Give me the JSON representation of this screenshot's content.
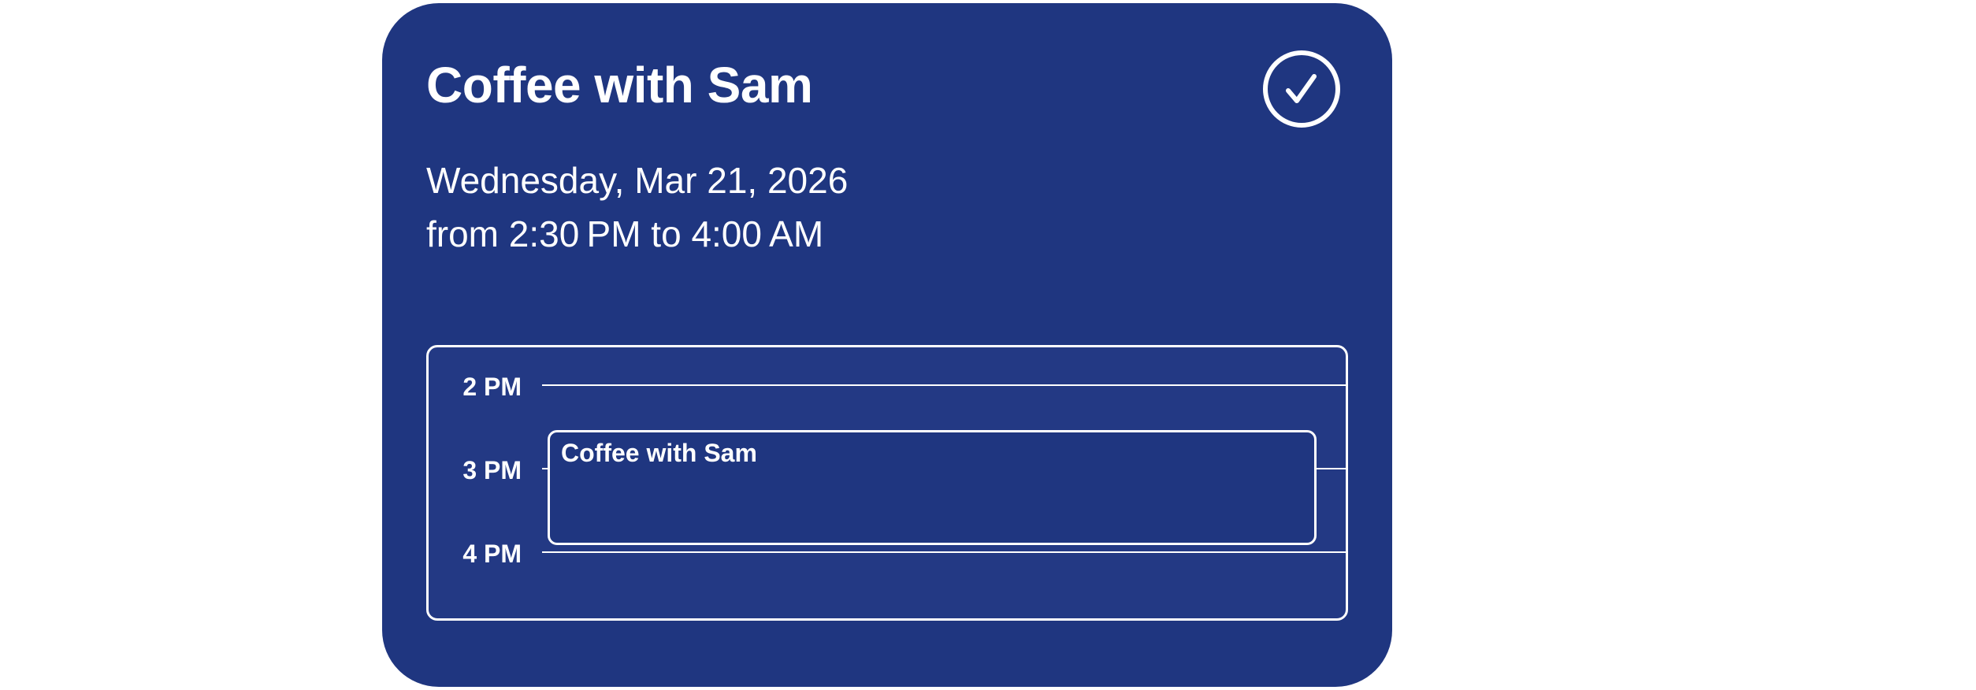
{
  "event": {
    "title": "Coffee with Sam",
    "date": "Wednesday, Mar 21, 2026",
    "time_range": "from 2:30 PM to 4:00 AM"
  },
  "done_button": {
    "icon": "checkmark-circle-icon"
  },
  "timeline": {
    "hours": [
      "2 PM",
      "3 PM",
      "4 PM"
    ],
    "event_label": "Coffee with Sam"
  },
  "colors": {
    "card_background": "#1f3680",
    "timeline_background": "#233984",
    "foreground": "#ffffff"
  }
}
